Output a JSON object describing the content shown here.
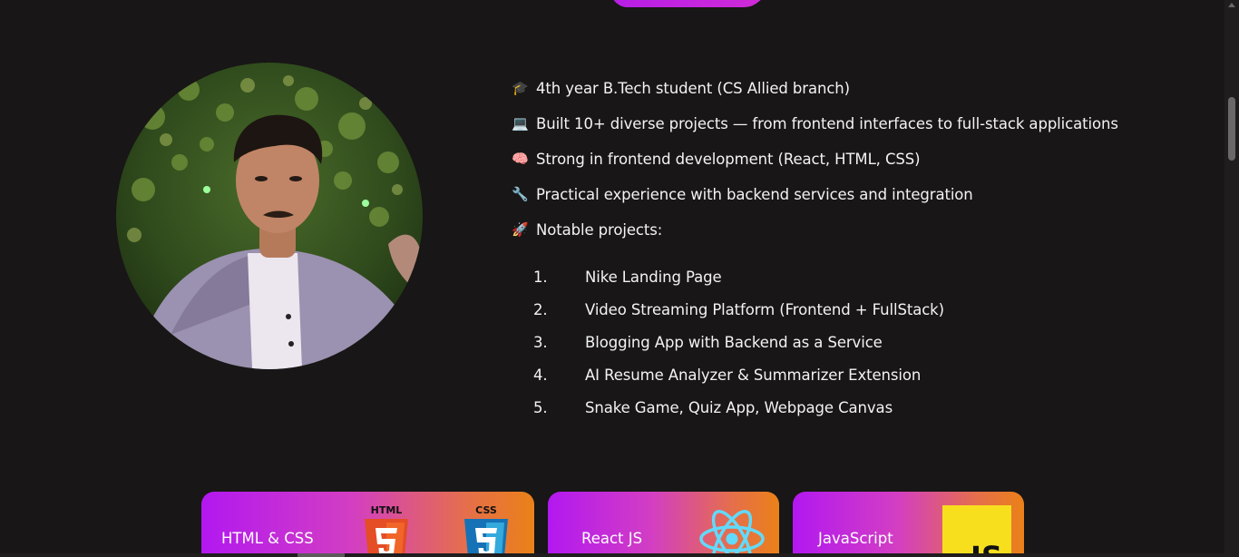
{
  "bio": {
    "items": [
      {
        "emoji": "🎓",
        "text": "4th year B.Tech student (CS Allied branch)"
      },
      {
        "emoji": "💻",
        "text": "Built 10+ diverse projects — from frontend interfaces to full-stack applications"
      },
      {
        "emoji": "🧠",
        "text": "Strong in frontend development (React, HTML, CSS)"
      },
      {
        "emoji": "🔧",
        "text": "Practical experience with backend services and integration"
      },
      {
        "emoji": "🚀",
        "text": "Notable projects:"
      }
    ],
    "projects": [
      {
        "num": "1.",
        "text": "Nike Landing Page"
      },
      {
        "num": "2.",
        "text": "Video Streaming Platform (Frontend + FullStack)"
      },
      {
        "num": "3.",
        "text": "Blogging App with Backend as a Service"
      },
      {
        "num": "4.",
        "text": "AI Resume Analyzer & Summarizer Extension"
      },
      {
        "num": "5.",
        "text": "Snake Game, Quiz App, Webpage Canvas"
      }
    ]
  },
  "skills": {
    "html_css": {
      "label": "HTML & CSS",
      "html_logo_text": "HTML",
      "css_logo_text": "CSS"
    },
    "react": {
      "label": "React JS"
    },
    "javascript": {
      "label": "JavaScript",
      "logo_text": "JS"
    }
  },
  "colors": {
    "background": "#181616",
    "accent_purple": "#b218f0",
    "accent_orange": "#ea8118",
    "html_orange": "#e44d26",
    "css_blue": "#1572b6",
    "react_cyan": "#61dafb",
    "js_yellow": "#f7df1e"
  }
}
